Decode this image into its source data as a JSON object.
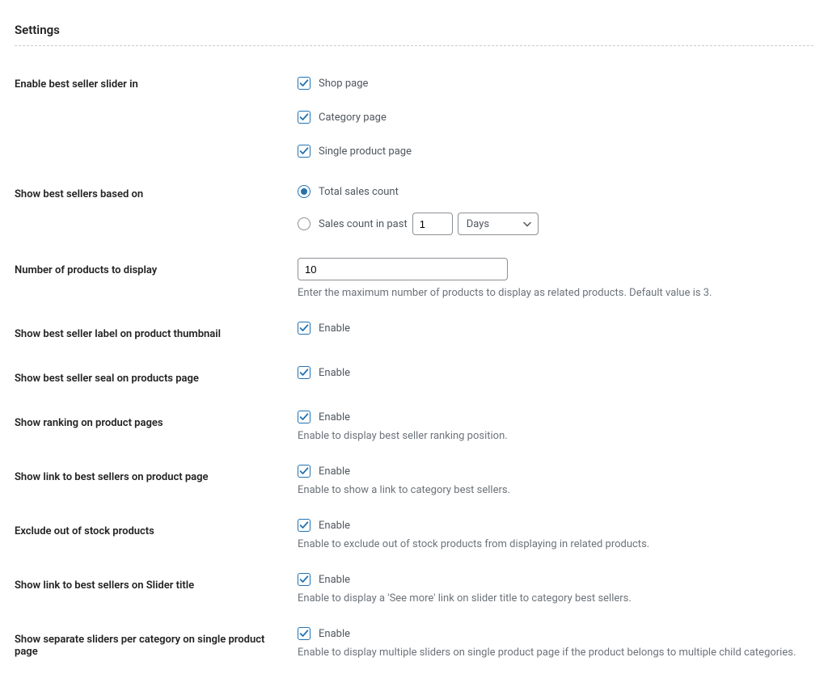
{
  "page_title": "Settings",
  "fields": {
    "enable_slider": {
      "label": "Enable best seller slider in",
      "opts": [
        "Shop page",
        "Category page",
        "Single product page"
      ]
    },
    "based_on": {
      "label": "Show best sellers based on",
      "radio1": "Total sales count",
      "radio2": "Sales count in past",
      "past_value": "1",
      "unit_selected": "Days"
    },
    "num_products": {
      "label": "Number of products to display",
      "value": "10",
      "help": "Enter the maximum number of products to display as related products. Default value is 3."
    },
    "label_thumb": {
      "label": "Show best seller label on product thumbnail",
      "cb": "Enable"
    },
    "seal_page": {
      "label": "Show best seller seal on products page",
      "cb": "Enable"
    },
    "ranking": {
      "label": "Show ranking on product pages",
      "cb": "Enable",
      "help": "Enable to display best seller ranking position."
    },
    "link_product": {
      "label": "Show link to best sellers on product page",
      "cb": "Enable",
      "help": "Enable to show a link to category best sellers."
    },
    "exclude_oos": {
      "label": "Exclude out of stock products",
      "cb": "Enable",
      "help": "Enable to exclude out of stock products from displaying in related products."
    },
    "link_slider_title": {
      "label": "Show link to best sellers on Slider title",
      "cb": "Enable",
      "help": "Enable to display a 'See more' link on slider title to category best sellers."
    },
    "separate_sliders": {
      "label": "Show separate sliders per category on single product page",
      "cb": "Enable",
      "help": "Enable to display multiple sliders on single product page if the product belongs to multiple child categories."
    }
  }
}
